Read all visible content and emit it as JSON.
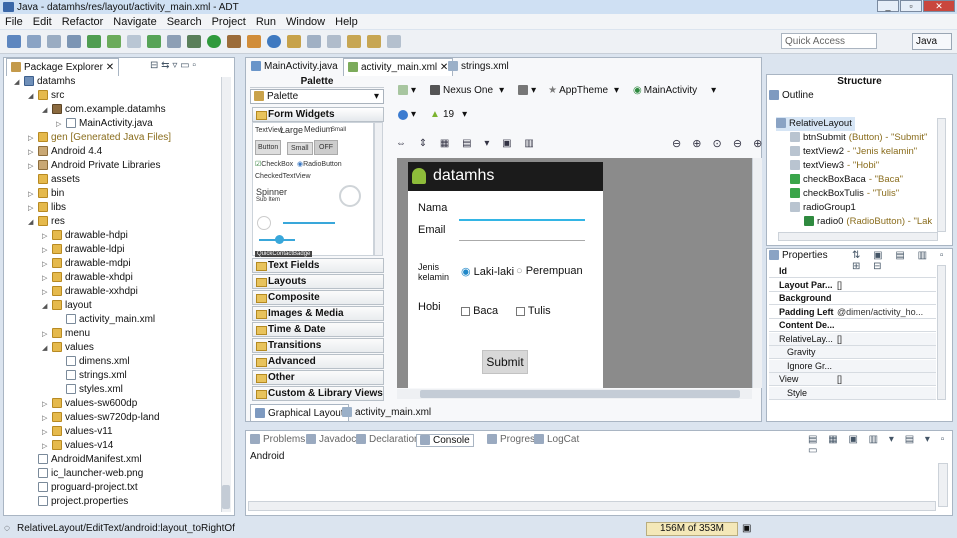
{
  "window": {
    "title": "Java - datamhs/res/layout/activity_main.xml - ADT",
    "min": "_",
    "restore": "▫",
    "close": "✕"
  },
  "menu": [
    "File",
    "Edit",
    "Refactor",
    "Navigate",
    "Search",
    "Project",
    "Run",
    "Window",
    "Help"
  ],
  "quick_access": {
    "placeholder": "Quick Access"
  },
  "perspective": "Java",
  "package_explorer": {
    "title": "Package Explorer",
    "tree": [
      {
        "label": "datamhs",
        "depth": 0,
        "type": "proj",
        "twisty": "◢"
      },
      {
        "label": "src",
        "depth": 1,
        "type": "folder",
        "twisty": "◢"
      },
      {
        "label": "com.example.datamhs",
        "depth": 2,
        "type": "pkg",
        "twisty": "◢"
      },
      {
        "label": "MainActivity.java",
        "depth": 3,
        "type": "file",
        "twisty": "▷"
      },
      {
        "label": "gen [Generated Java Files]",
        "depth": 1,
        "type": "folder",
        "twisty": "▷",
        "muted": true
      },
      {
        "label": "Android 4.4",
        "depth": 1,
        "type": "jar",
        "twisty": "▷"
      },
      {
        "label": "Android Private Libraries",
        "depth": 1,
        "type": "jar",
        "twisty": "▷"
      },
      {
        "label": "assets",
        "depth": 1,
        "type": "folder",
        "twisty": ""
      },
      {
        "label": "bin",
        "depth": 1,
        "type": "folder",
        "twisty": "▷"
      },
      {
        "label": "libs",
        "depth": 1,
        "type": "folder",
        "twisty": "▷"
      },
      {
        "label": "res",
        "depth": 1,
        "type": "folder",
        "twisty": "◢"
      },
      {
        "label": "drawable-hdpi",
        "depth": 2,
        "type": "folder",
        "twisty": "▷"
      },
      {
        "label": "drawable-ldpi",
        "depth": 2,
        "type": "folder",
        "twisty": "▷"
      },
      {
        "label": "drawable-mdpi",
        "depth": 2,
        "type": "folder",
        "twisty": "▷"
      },
      {
        "label": "drawable-xhdpi",
        "depth": 2,
        "type": "folder",
        "twisty": "▷"
      },
      {
        "label": "drawable-xxhdpi",
        "depth": 2,
        "type": "folder",
        "twisty": "▷"
      },
      {
        "label": "layout",
        "depth": 2,
        "type": "folder",
        "twisty": "◢"
      },
      {
        "label": "activity_main.xml",
        "depth": 3,
        "type": "file",
        "twisty": ""
      },
      {
        "label": "menu",
        "depth": 2,
        "type": "folder",
        "twisty": "▷"
      },
      {
        "label": "values",
        "depth": 2,
        "type": "folder",
        "twisty": "◢"
      },
      {
        "label": "dimens.xml",
        "depth": 3,
        "type": "file",
        "twisty": ""
      },
      {
        "label": "strings.xml",
        "depth": 3,
        "type": "file",
        "twisty": ""
      },
      {
        "label": "styles.xml",
        "depth": 3,
        "type": "file",
        "twisty": ""
      },
      {
        "label": "values-sw600dp",
        "depth": 2,
        "type": "folder",
        "twisty": "▷"
      },
      {
        "label": "values-sw720dp-land",
        "depth": 2,
        "type": "folder",
        "twisty": "▷"
      },
      {
        "label": "values-v11",
        "depth": 2,
        "type": "folder",
        "twisty": "▷"
      },
      {
        "label": "values-v14",
        "depth": 2,
        "type": "folder",
        "twisty": "▷"
      },
      {
        "label": "AndroidManifest.xml",
        "depth": 1,
        "type": "file",
        "twisty": ""
      },
      {
        "label": "ic_launcher-web.png",
        "depth": 1,
        "type": "file",
        "twisty": ""
      },
      {
        "label": "proguard-project.txt",
        "depth": 1,
        "type": "file",
        "twisty": ""
      },
      {
        "label": "project.properties",
        "depth": 1,
        "type": "file",
        "twisty": ""
      }
    ]
  },
  "editor_tabs": [
    "MainActivity.java",
    "activity_main.xml",
    "strings.xml"
  ],
  "palette": {
    "title": "Palette",
    "dropdown": "Palette",
    "open_category": "Form Widgets",
    "widgets": {
      "textview": "TextView",
      "large": "Large",
      "medium": "Medium",
      "small": "Small",
      "button": "Button",
      "small_btn": "Small",
      "off": "OFF",
      "checkbox": "CheckBox",
      "radio": "RadioButton",
      "checked_tv": "CheckedTextView",
      "spinner": "Spinner",
      "spinner_sub": "Sub Item",
      "quick": "QuickContactBadge"
    },
    "categories": [
      "Text Fields",
      "Layouts",
      "Composite",
      "Images & Media",
      "Time & Date",
      "Transitions",
      "Advanced",
      "Other",
      "Custom & Library Views"
    ]
  },
  "canvas_toolbar": {
    "device": "Nexus One",
    "theme": "AppTheme",
    "activity": "MainActivity",
    "api": "19"
  },
  "phone": {
    "app_title": "datamhs",
    "nama": "Nama",
    "email": "Email",
    "jenis": "Jenis\nkelamin",
    "laki": "Laki-laki",
    "perempuan": "Perempuan",
    "hobi": "Hobi",
    "baca": "Baca",
    "tulis": "Tulis",
    "submit": "Submit"
  },
  "editor_bottom_tabs": [
    "Graphical Layout",
    "activity_main.xml"
  ],
  "structure": {
    "title": "Structure",
    "outline": "Outline",
    "tree": [
      {
        "label": "RelativeLayout",
        "depth": 0
      },
      {
        "label": "btnSubmit",
        "extra": "(Button) - \"Submit\"",
        "depth": 1
      },
      {
        "label": "textView2",
        "extra": "- \"Jenis kelamin\"",
        "depth": 1
      },
      {
        "label": "textView3",
        "extra": "- \"Hobi\"",
        "depth": 1
      },
      {
        "label": "checkBoxBaca",
        "extra": "- \"Baca\"",
        "depth": 1
      },
      {
        "label": "checkBoxTulis",
        "extra": "- \"Tulis\"",
        "depth": 1
      },
      {
        "label": "radioGroup1",
        "extra": "",
        "depth": 1
      },
      {
        "label": "radio0",
        "extra": "(RadioButton) - \"Lak",
        "depth": 2
      }
    ]
  },
  "properties": {
    "title": "Properties",
    "rows": [
      {
        "k": "Id",
        "v": "",
        "bold": true
      },
      {
        "k": "Layout Par...",
        "v": "[]",
        "bold": true
      },
      {
        "k": "Background",
        "v": "",
        "bold": true
      },
      {
        "k": "Padding Left",
        "v": "@dimen/activity_ho...",
        "bold": true
      },
      {
        "k": "Content De...",
        "v": "",
        "bold": true
      },
      {
        "k": "RelativeLay...",
        "v": "[]",
        "bold": false
      },
      {
        "k": "Gravity",
        "v": "",
        "bold": false
      },
      {
        "k": "Ignore Gr...",
        "v": "",
        "bold": false
      },
      {
        "k": "View",
        "v": "[]",
        "bold": false
      },
      {
        "k": "Style",
        "v": "",
        "bold": false
      }
    ]
  },
  "bottom_tabs": [
    "Problems",
    "Javadoc",
    "Declaration",
    "Console",
    "Progress",
    "LogCat"
  ],
  "console": {
    "label": "Android"
  },
  "status": {
    "left": "RelativeLayout/EditText/android:layout_toRightOf",
    "heap": "156M of 353M"
  }
}
